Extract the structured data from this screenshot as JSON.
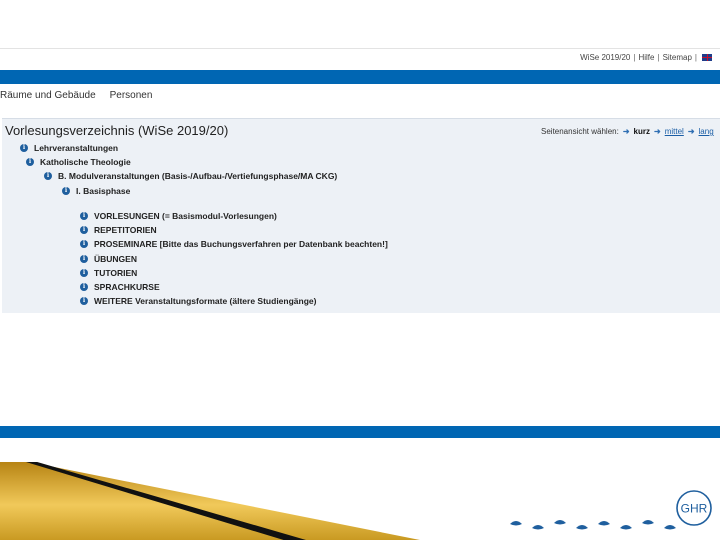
{
  "utility": {
    "semester": "WiSe 2019/20",
    "sep1": "|",
    "help": "Hilfe",
    "sep2": "|",
    "sitemap": "Sitemap",
    "sep3": "|",
    "language_icon": "uk-flag-icon"
  },
  "nav": {
    "items": [
      "Räume und Gebäude",
      "Personen"
    ]
  },
  "panel": {
    "title": "Vorlesungsverzeichnis (WiSe 2019/20)",
    "view_label": "Seitenansicht wählen:",
    "view_options": [
      "kurz",
      "mittel",
      "lang"
    ]
  },
  "tree": {
    "level0": "Lehrveranstaltungen",
    "level1": "Katholische Theologie",
    "level2": "B. Modulveranstaltungen (Basis-/Aufbau-/Vertiefungsphase/MA CKG)",
    "level3": "I. Basisphase",
    "items": [
      "VORLESUNGEN (= Basismodul-Vorlesungen)",
      "REPETITORIEN",
      "PROSEMINARE [Bitte das Buchungsverfahren per Datenbank beachten!]",
      "ÜBUNGEN",
      "TUTORIEN",
      "SPRACHKURSE",
      "WEITERE Veranstaltungsformate (ältere Studiengänge)"
    ]
  },
  "logo": {
    "text": "GHR"
  },
  "colors": {
    "brand_blue": "#0066b3",
    "panel_bg": "#edf1f6",
    "icon_blue": "#1f5f9e"
  }
}
